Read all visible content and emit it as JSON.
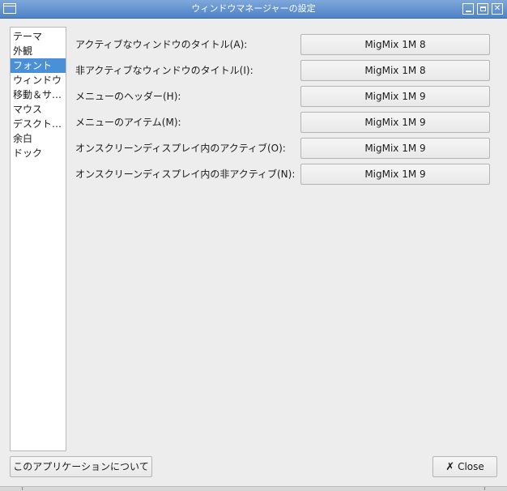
{
  "window": {
    "title": "ウィンドウマネージャーの設定",
    "buttons": {
      "minimize": "minimize",
      "maximize": "maximize",
      "close": "✕"
    }
  },
  "sidebar": {
    "items": [
      {
        "label": "テーマ",
        "selected": false
      },
      {
        "label": "外観",
        "selected": false
      },
      {
        "label": "フォント",
        "selected": true
      },
      {
        "label": "ウィンドウ",
        "selected": false
      },
      {
        "label": "移動＆サ…",
        "selected": false
      },
      {
        "label": "マウス",
        "selected": false
      },
      {
        "label": "デスクト…",
        "selected": false
      },
      {
        "label": "余白",
        "selected": false
      },
      {
        "label": "ドック",
        "selected": false
      }
    ]
  },
  "fonts": {
    "rows": [
      {
        "label": "アクティブなウィンドウのタイトル(A):",
        "value": "MigMix 1M 8"
      },
      {
        "label": "非アクティブなウィンドウのタイトル(I):",
        "value": "MigMix 1M 8"
      },
      {
        "label": "メニューのヘッダー(H):",
        "value": "MigMix 1M 9"
      },
      {
        "label": "メニューのアイテム(M):",
        "value": "MigMix 1M 9"
      },
      {
        "label": "オンスクリーンディスプレイ内のアクティブ(O):",
        "value": "MigMix 1M 9"
      },
      {
        "label": "オンスクリーンディスプレイ内の非アクティブ(N):",
        "value": "MigMix 1M 9"
      }
    ]
  },
  "footer": {
    "about_label": "このアプリケーションについて",
    "close_label": "Close",
    "close_icon": "✗"
  },
  "colors": {
    "titlebar": "#4f82c6",
    "selection": "#4a90d9"
  }
}
